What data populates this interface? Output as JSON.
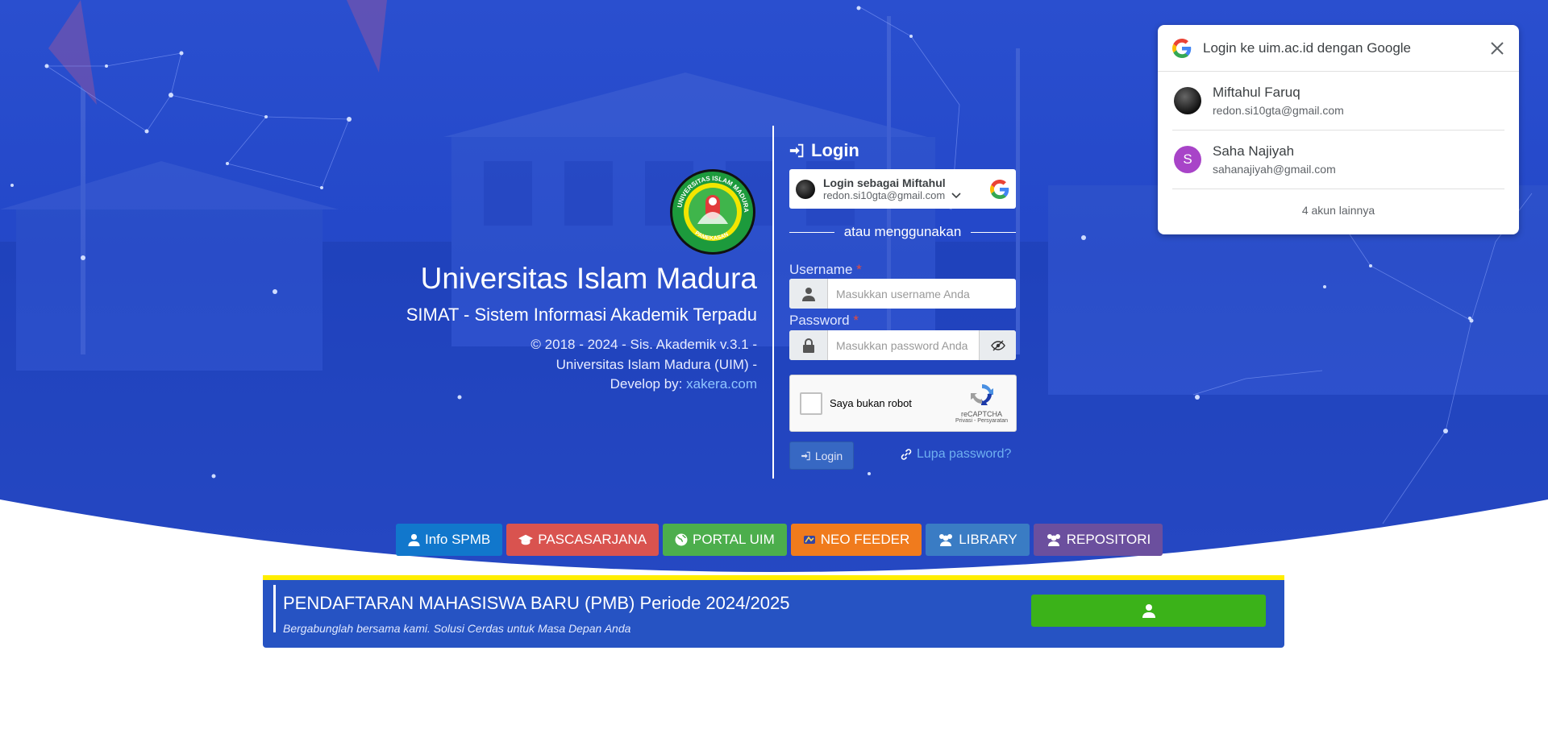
{
  "brand": {
    "university": "Universitas Islam Madura",
    "system": "SIMAT - Sistem Informasi Akademik Terpadu",
    "copyright_line1": "© 2018 - 2024 - Sis. Akademik v.3.1 -",
    "copyright_line2": "Universitas Islam Madura (UIM) -",
    "develop_prefix": "Develop by:",
    "develop_link": "xakera.com",
    "logo_text_top": "UNIVERSITAS ISLAM MADURA",
    "logo_text_bottom": "PAMEKASAN"
  },
  "login": {
    "title": "Login",
    "google_button": {
      "title": "Login sebagai Miftahul",
      "email": "redon.si10gta@gmail.com"
    },
    "or_text": "atau menggunakan",
    "username_label": "Username",
    "username_placeholder": "Masukkan username Anda",
    "password_label": "Password",
    "password_placeholder": "Masukkan password Anda",
    "required_mark": "*",
    "captcha_text": "Saya bukan robot",
    "captcha_brand": "reCAPTCHA",
    "captcha_links": "Privasi - Persyaratan",
    "submit_label": "Login",
    "forgot_label": "Lupa password?"
  },
  "google_popup": {
    "title": "Login ke uim.ac.id dengan Google",
    "accounts": [
      {
        "name": "Miftahul Faruq",
        "email": "redon.si10gta@gmail.com",
        "initial": ""
      },
      {
        "name": "Saha Najiyah",
        "email": "sahanajiyah@gmail.com",
        "initial": "S"
      }
    ],
    "more": "4 akun lainnya"
  },
  "quick_links": [
    {
      "label": "Info SPMB",
      "color": "#1177cc",
      "icon": "user-icon"
    },
    {
      "label": "PASCASARJANA",
      "color": "#d9534f",
      "icon": "graduation-cap-icon"
    },
    {
      "label": "PORTAL UIM",
      "color": "#4cae4c",
      "icon": "globe-icon"
    },
    {
      "label": "NEO FEEDER",
      "color": "#f07b1d",
      "icon": "neo-feeder-icon"
    },
    {
      "label": "LIBRARY",
      "color": "#3a7cc4",
      "icon": "users-icon"
    },
    {
      "label": "REPOSITORI",
      "color": "#6b4f9e",
      "icon": "users-icon"
    }
  ],
  "pmb": {
    "title": "PENDAFTARAN MAHASISWA BARU (PMB) Periode 2024/2025",
    "subtitle": "Bergabunglah bersama kami. Solusi Cerdas untuk Masa Depan Anda"
  },
  "colors": {
    "hero_blue": "#2347c8",
    "banner_blue": "#2653c3",
    "banner_accent": "#ffee00",
    "register_green": "#3bb219"
  }
}
